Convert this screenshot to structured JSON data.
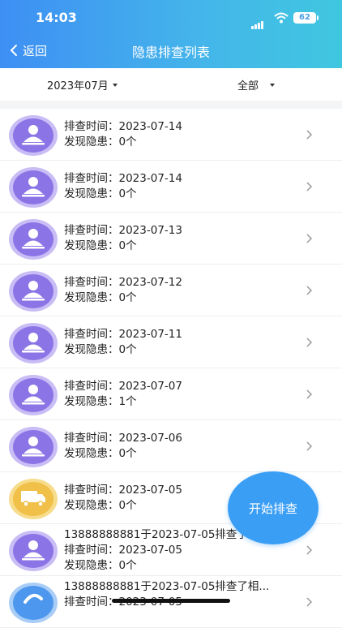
{
  "status_bar": {
    "time": "14:03",
    "battery": "62"
  },
  "nav": {
    "back_label": "返回",
    "title": "隐患排查列表"
  },
  "filters": {
    "month": "2023年07月",
    "type": "全部"
  },
  "records": [
    {
      "line1": "排查时间：2023-07-14",
      "line2": "发现隐患：0个",
      "avatar": "person"
    },
    {
      "line1": "排查时间：2023-07-14",
      "line2": "发现隐患：0个",
      "avatar": "person"
    },
    {
      "line1": "排查时间：2023-07-13",
      "line2": "发现隐患：0个",
      "avatar": "person"
    },
    {
      "line1": "排查时间：2023-07-12",
      "line2": "发现隐患：0个",
      "avatar": "person"
    },
    {
      "line1": "排查时间：2023-07-11",
      "line2": "发现隐患：0个",
      "avatar": "person"
    },
    {
      "line1": "排查时间：2023-07-07",
      "line2": "发现隐患：1个",
      "avatar": "person"
    },
    {
      "line1": "排查时间：2023-07-06",
      "line2": "发现隐患：0个",
      "avatar": "person"
    },
    {
      "line1": "排查时间：2023-07-05",
      "line2": "发现隐患：0个",
      "avatar": "truck"
    },
    {
      "line0": "13888888881于2023-07-05排查了...",
      "line1": "排查时间：2023-07-05",
      "line2": "发现隐患：0个",
      "avatar": "person"
    },
    {
      "line0": "13888888881于2023-07-05排查了相...",
      "line1": "排查时间：2023-07-05",
      "avatar": "blue"
    }
  ],
  "fab_label": "开始排查",
  "colors": {
    "header_start": "#3e8ff4",
    "header_end": "#3fc7df",
    "fab": "#3b9ef5",
    "avatar_purple": "#8b74e6",
    "avatar_yellow": "#f2c04c"
  }
}
